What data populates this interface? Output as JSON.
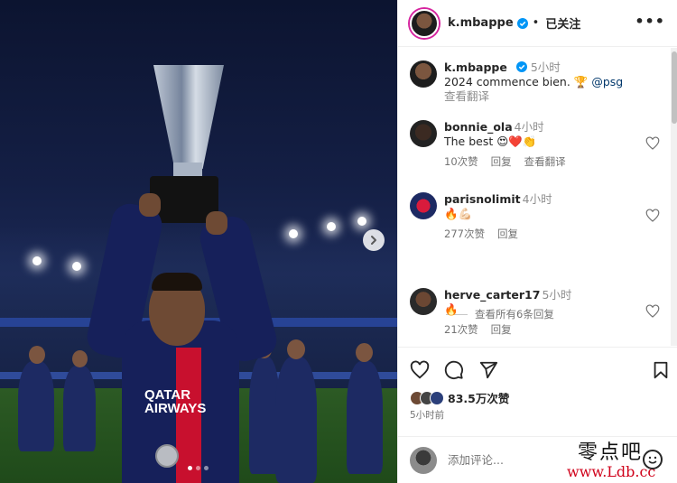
{
  "media": {
    "sponsor": "QATAR AIRWAYS",
    "carousel": {
      "slides": 3,
      "active": 0
    }
  },
  "header": {
    "username": "k.mbappe",
    "follow_label": "已关注",
    "more_icon": "more-horizontal-icon"
  },
  "caption": {
    "username": "k.mbappe",
    "time": "5小时",
    "text": "2024 commence bien. 🏆 ",
    "mention": "@psg",
    "translate": "查看翻译"
  },
  "comments": [
    {
      "username": "bonnie_ola",
      "time": "4小时",
      "text": "The best 😍❤️👏",
      "likes": "10次赞",
      "reply": "回复",
      "translate": "查看翻译"
    },
    {
      "username": "parisnolimit",
      "time": "4小时",
      "text": "🔥💪🏻",
      "likes": "277次赞",
      "reply": "回复"
    },
    {
      "username": "herve_carter17",
      "time": "5小时",
      "text": "🔥",
      "likes": "21次赞",
      "reply": "回复"
    }
  ],
  "view_replies": "查看所有6条回复",
  "actions": {
    "like_count": "83.5万次赞",
    "post_time": "5小时前"
  },
  "add_comment": {
    "placeholder": "添加评论..."
  },
  "watermark": {
    "line1": "零点吧",
    "line2": "www.Ldb.cc"
  },
  "colors": {
    "link": "#00376b",
    "verified": "#0095f6",
    "story_ring": "#d6249f"
  }
}
